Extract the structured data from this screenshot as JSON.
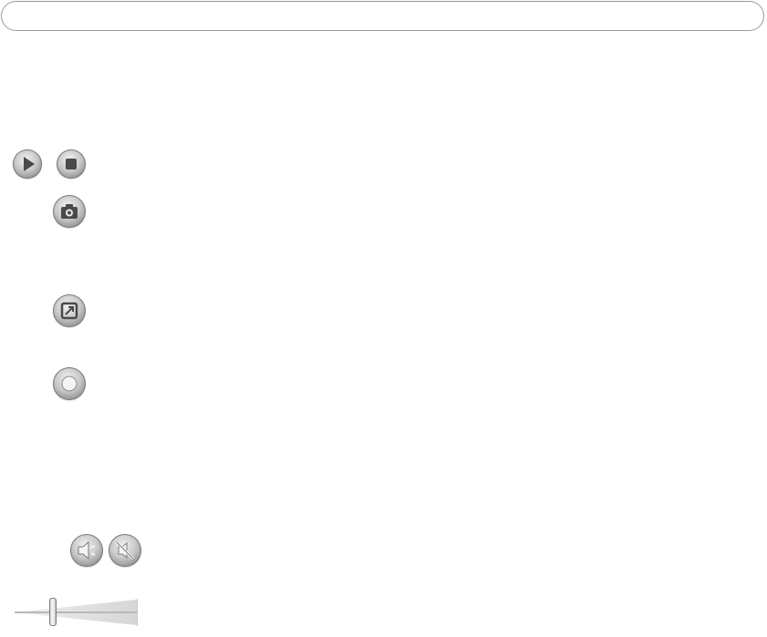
{
  "toolbar": {
    "address_bar_value": ""
  },
  "controls": {
    "play": {
      "icon": "play-icon"
    },
    "stop": {
      "icon": "stop-icon"
    },
    "snapshot": {
      "icon": "camera-icon"
    },
    "expand": {
      "icon": "expand-icon"
    },
    "record": {
      "icon": "record-icon"
    }
  },
  "audio": {
    "speaker": {
      "icon": "speaker-icon"
    },
    "mute": {
      "icon": "mute-icon"
    },
    "volume_fraction": 0.3
  },
  "colors": {
    "button_face": "#c8c8c8",
    "button_dark": "#7a7a7a",
    "glyph": "#555555",
    "border": "#9a9a9a"
  }
}
